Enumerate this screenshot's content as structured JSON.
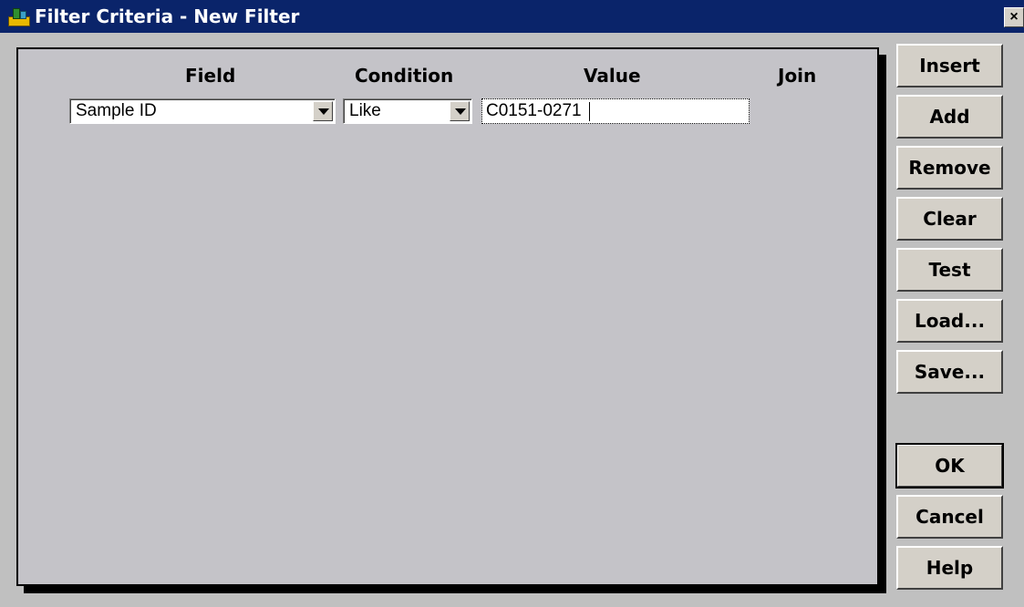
{
  "window": {
    "title": "Filter Criteria - New Filter",
    "close_glyph": "×"
  },
  "columns": {
    "field": "Field",
    "condition": "Condition",
    "value": "Value",
    "join": "Join"
  },
  "criteria_row": {
    "field": "Sample ID",
    "condition": "Like",
    "value": "C0151-0271"
  },
  "buttons": {
    "insert": "Insert",
    "add": "Add",
    "remove": "Remove",
    "clear": "Clear",
    "test": "Test",
    "load": "Load...",
    "save": "Save...",
    "ok": "OK",
    "cancel": "Cancel",
    "help": "Help"
  },
  "icons": {
    "app": "app-crane-icon",
    "dropdown": "chevron-down-icon"
  },
  "colors": {
    "titlebar": "#0a246a",
    "panel": "#c4c3c8",
    "button_face": "#d4d0c8"
  }
}
